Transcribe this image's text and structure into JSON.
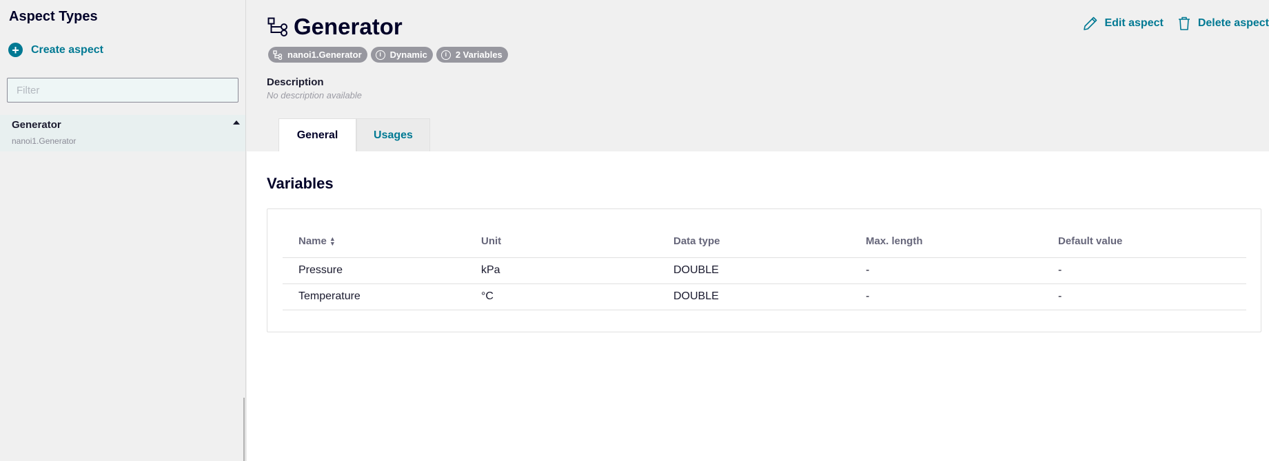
{
  "sidebar": {
    "title": "Aspect Types",
    "create_label": "Create aspect",
    "filter_placeholder": "Filter",
    "items": [
      {
        "name": "Generator",
        "subtitle": "nanoi1.Generator"
      }
    ]
  },
  "header": {
    "title": "Generator",
    "badges": [
      {
        "icon": "hierarchy-icon",
        "label": "nanoi1.Generator"
      },
      {
        "icon": "info-icon",
        "label": "Dynamic"
      },
      {
        "icon": "info-icon",
        "label": "2 Variables"
      }
    ],
    "description_label": "Description",
    "description_value": "No description available",
    "edit_label": "Edit aspect",
    "delete_label": "Delete aspect"
  },
  "tabs": [
    {
      "label": "General",
      "active": true
    },
    {
      "label": "Usages",
      "active": false
    }
  ],
  "variables": {
    "title": "Variables",
    "columns": [
      "Name",
      "Unit",
      "Data type",
      "Max. length",
      "Default value"
    ],
    "rows": [
      [
        "Pressure",
        "kPa",
        "DOUBLE",
        "-",
        "-"
      ],
      [
        "Temperature",
        "°C",
        "DOUBLE",
        "-",
        "-"
      ]
    ]
  },
  "colors": {
    "accent": "#007993",
    "badge": "#97979f",
    "title": "#000028"
  }
}
